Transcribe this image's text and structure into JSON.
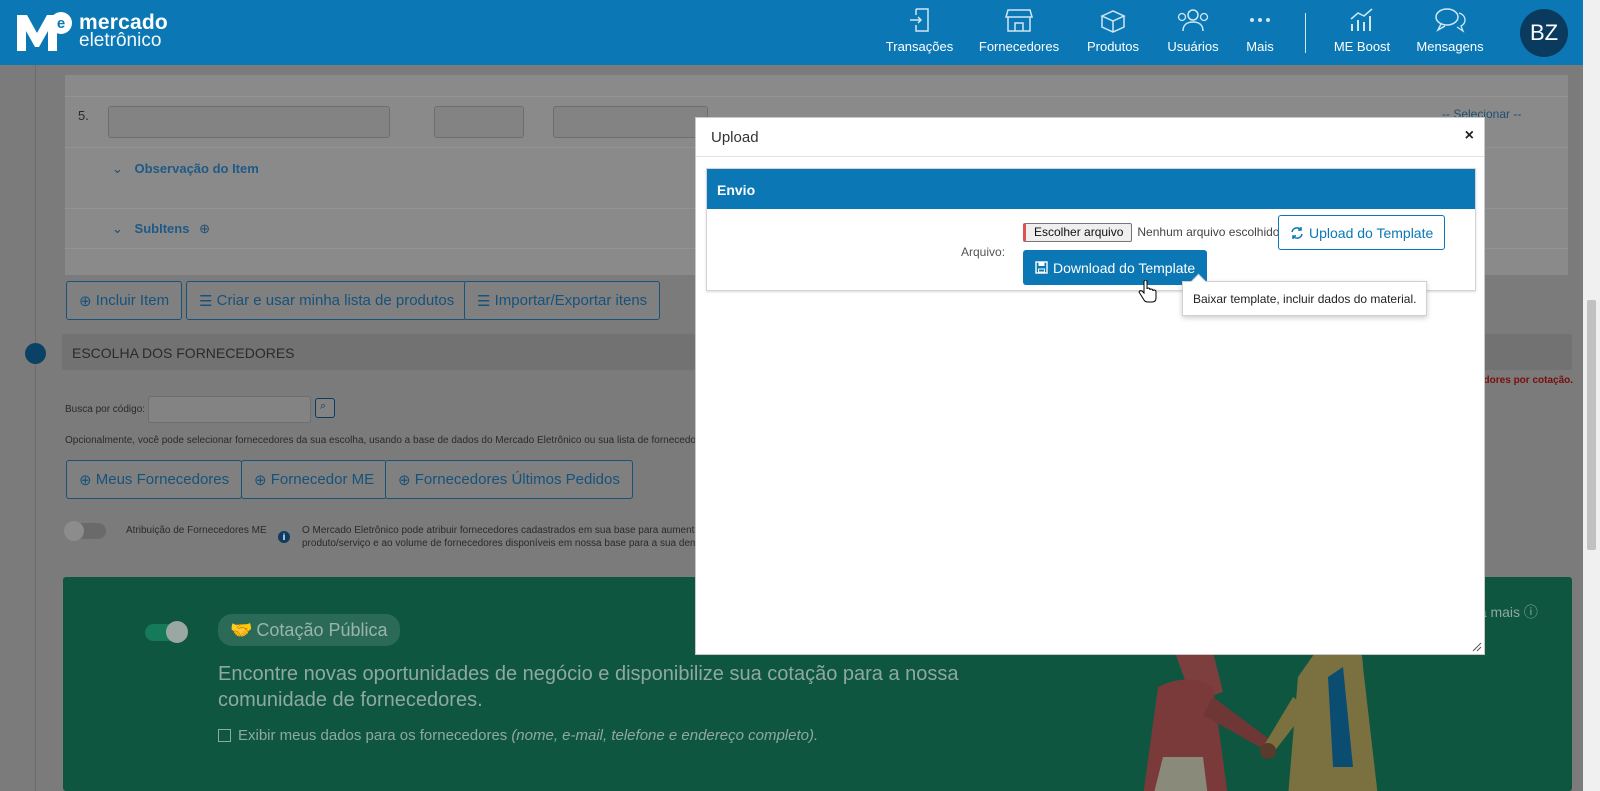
{
  "brand": {
    "line1": "mercado",
    "line2": "eletrônico",
    "mark": "Me"
  },
  "nav": {
    "items": [
      {
        "label": "Transações",
        "icon": "transactions-icon"
      },
      {
        "label": "Fornecedores",
        "icon": "store-icon"
      },
      {
        "label": "Produtos",
        "icon": "box-icon"
      },
      {
        "label": "Usuários",
        "icon": "users-icon"
      },
      {
        "label": "Mais",
        "icon": "more-icon"
      },
      {
        "label": "ME Boost",
        "icon": "chart-icon"
      },
      {
        "label": "Mensagens",
        "icon": "chat-icon"
      }
    ],
    "avatar": "BZ"
  },
  "items_area": {
    "row_number": "5.",
    "select_placeholder": "-- Selecionar --",
    "observacao_label": "Observação do Item",
    "subitens_label": "SubItens"
  },
  "item_actions": {
    "incluir": "Incluir Item",
    "criar_lista": "Criar e usar minha lista de produtos",
    "importar": "Importar/Exportar itens"
  },
  "suppliers": {
    "section_title": "ESCOLHA DOS FORNECEDORES",
    "search_label": "Busca por código:",
    "helper_text": "Opcionalmente, você pode selecionar fornecedores da sua escolha, usando a base de dados do Mercado Eletrônico ou sua lista de fornecedor",
    "red_note": "edores por cotação.",
    "buttons": {
      "meus": "Meus Fornecedores",
      "me": "Fornecedor ME",
      "ultimos": "Fornecedores Últimos Pedidos"
    },
    "atribuicao_label": "Atribuição de Fornecedores ME",
    "atribuicao_text1": "O Mercado Eletrônico pode atribuir fornecedores cadastrados em sua base para aumenta",
    "atribuicao_text2": "produto/serviço e ao volume de fornecedores disponíveis em nossa base para a sua dem"
  },
  "public_quote": {
    "pill": "Cotação Pública",
    "headline": "Encontre novas oportunidades de negócio e disponibilize sua cotação para a nossa comunidade de fornecedores.",
    "checkbox_label": "Exibir meus dados para os fornecedores",
    "checkbox_note": "(nome, e-mail, telefone e endereço completo).",
    "saiba_mais": "ba mais"
  },
  "modal": {
    "title": "Upload",
    "close": "×",
    "section": "Envio",
    "arquivo_label": "Arquivo:",
    "file_button": "Escolher arquivo",
    "file_status": "Nenhum arquivo escolhido",
    "upload_button": "Upload do Template",
    "download_button": "Download do Template",
    "tooltip": "Baixar template, incluir dados do material."
  },
  "colors": {
    "brand_blue": "#0b78b5",
    "green": "#2aa57d",
    "avatar": "#0a3a5e"
  }
}
